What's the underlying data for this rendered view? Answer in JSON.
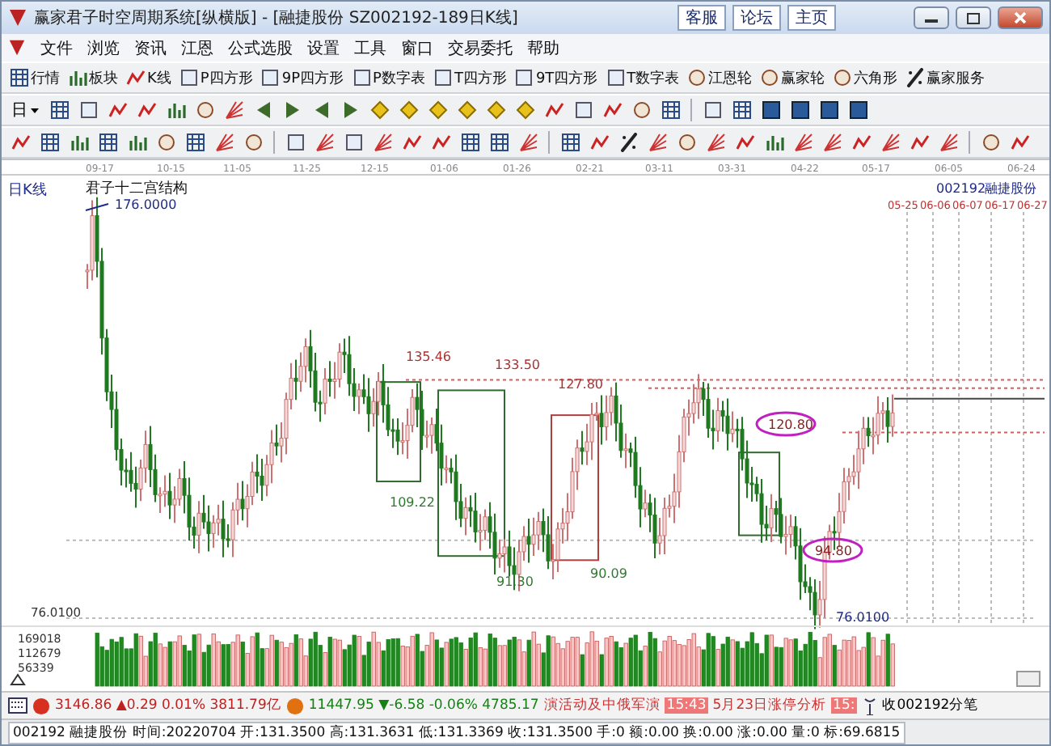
{
  "window": {
    "title": "赢家君子时空周期系统[纵横版] - [融捷股份  SZ002192-189日K线]",
    "buttons": [
      "客服",
      "论坛",
      "主页"
    ]
  },
  "menu": [
    "文件",
    "浏览",
    "资讯",
    "江恩",
    "公式选股",
    "设置",
    "工具",
    "窗口",
    "交易委托",
    "帮助"
  ],
  "toolbar": [
    "行情",
    "板块",
    "K线",
    "P四方形",
    "9P四方形",
    "P数字表",
    "T四方形",
    "9T四方形",
    "T数字表",
    "江恩轮",
    "赢家轮",
    "六角形",
    "赢家服务"
  ],
  "period_select": {
    "value": "日"
  },
  "chart": {
    "period_label": "日K线",
    "title": "君子十二宫结构",
    "code": "002192",
    "name": "融捷股份",
    "dates": [
      "09-17",
      "10-15",
      "11-05",
      "11-25",
      "12-15",
      "01-06",
      "01-26",
      "02-21",
      "03-11",
      "03-31",
      "04-22",
      "05-17",
      "06-05",
      "06-24"
    ],
    "marker_dates": [
      "05-25",
      "06-06",
      "06-07",
      "06-17",
      "06-27"
    ],
    "price_labels": [
      {
        "text": "176.0000",
        "kind": "extreme"
      },
      {
        "text": "135.46",
        "kind": "peak"
      },
      {
        "text": "133.50",
        "kind": "peak"
      },
      {
        "text": "127.80",
        "kind": "peak"
      },
      {
        "text": "120.80",
        "kind": "circled"
      },
      {
        "text": "109.22",
        "kind": "trough"
      },
      {
        "text": "91.30",
        "kind": "trough"
      },
      {
        "text": "90.09",
        "kind": "trough"
      },
      {
        "text": "94.80",
        "kind": "circled"
      },
      {
        "text": "76.0100",
        "kind": "extreme"
      }
    ],
    "axis_low": "76.0100",
    "volume_ticks": [
      "169018",
      "112679",
      "56339"
    ]
  },
  "index_bar": {
    "quotes": [
      "3146.86 ▲0.29 0.01% 3811.79亿",
      "11447.95 ▼-6.58 -0.06% 4785.17"
    ],
    "news": "演活动及中俄军演",
    "items": [
      {
        "time": "15:43",
        "text": "5月23日涨停分析"
      },
      {
        "time": "15:"
      }
    ],
    "action": "收002192分笔"
  },
  "status_bar": "002192 融捷股份 时间:20220704 开:131.3500 高:131.3631 低:131.3369 收:131.3500 手:0 额:0.00 换:0.00 涨:0.00 量:0 标:69.6815"
}
